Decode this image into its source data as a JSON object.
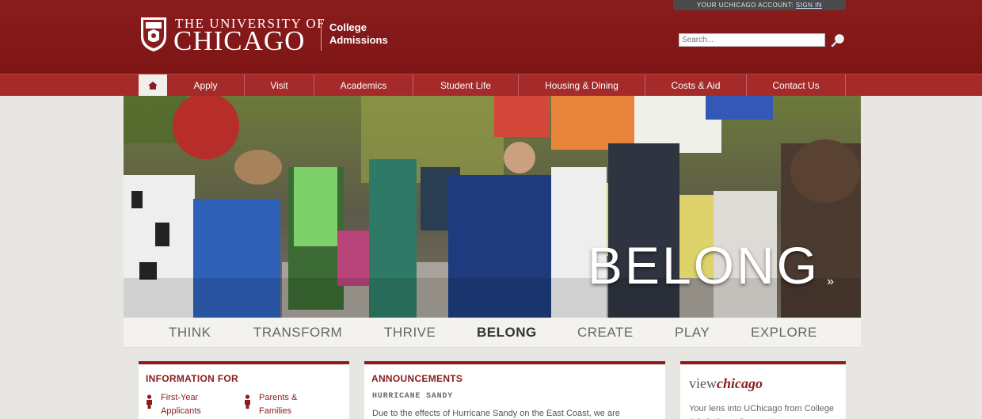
{
  "account_bar": {
    "label": "YOUR UCHICAGO ACCOUNT:",
    "sign_in": "SIGN IN"
  },
  "brand": {
    "line1": "THE UNIVERSITY OF",
    "line2": "CHICAGO",
    "dept_line1": "College",
    "dept_line2": "Admissions"
  },
  "search": {
    "placeholder": "Search..."
  },
  "nav": {
    "items": [
      "Apply",
      "Visit",
      "Academics",
      "Student Life",
      "Housing & Dining",
      "Costs & Aid",
      "Contact Us"
    ]
  },
  "hero": {
    "word": "BELONG",
    "arrow": "»"
  },
  "tabs": {
    "items": [
      "THINK",
      "TRANSFORM",
      "THRIVE",
      "BELONG",
      "CREATE",
      "PLAY",
      "EXPLORE"
    ],
    "active": "BELONG"
  },
  "info_for": {
    "title": "INFORMATION FOR",
    "item1_line1": "First-Year",
    "item1_line2": "Applicants",
    "item2_line1": "Parents &",
    "item2_line2": "Families"
  },
  "announcements": {
    "title": "ANNOUNCEMENTS",
    "subtitle": "HURRICANE SANDY",
    "text": "Due to the effects of Hurricane Sandy on the East Coast, we are"
  },
  "view_chicago": {
    "logo_view": "view",
    "logo_chicago": "chicago",
    "text": "Your lens into UChicago from College Admissions. Connect »"
  },
  "colors": {
    "maroon": "#8a1c1c",
    "nav": "#a52a2a"
  }
}
